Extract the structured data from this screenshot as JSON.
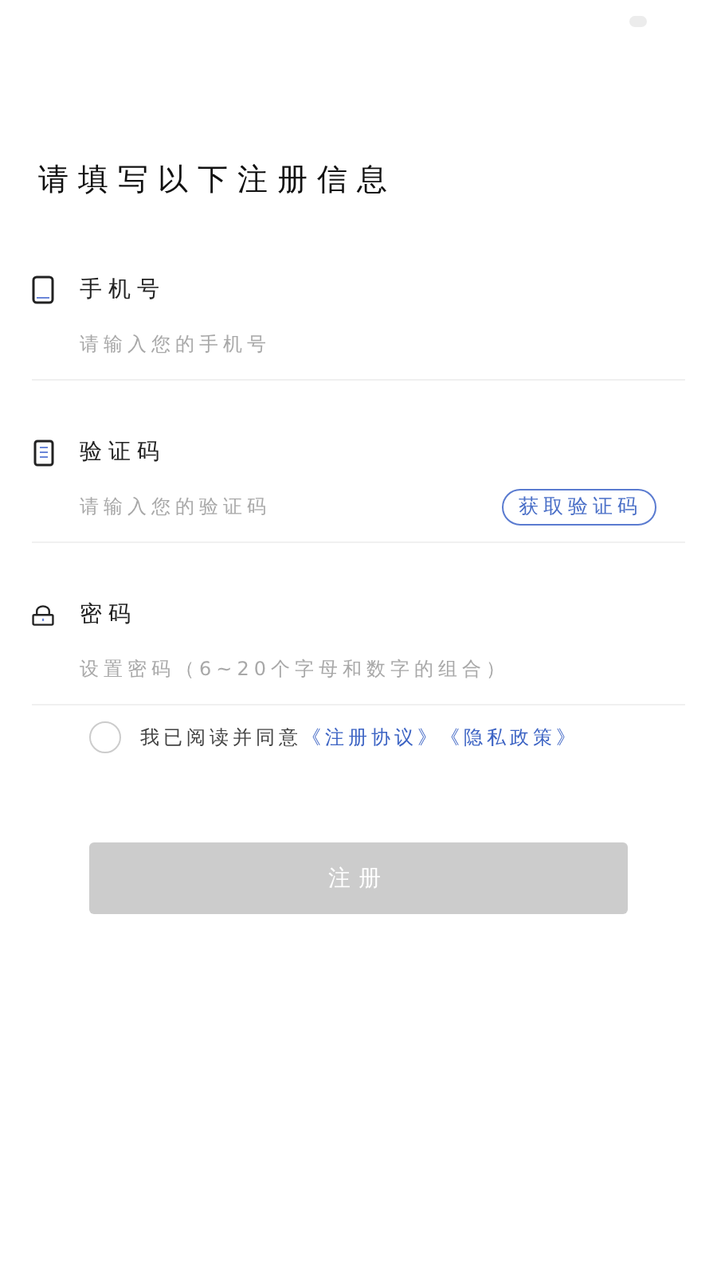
{
  "title": "请填写以下注册信息",
  "fields": [
    {
      "kind": "phone",
      "label": "手机号",
      "placeholder": "请输入您的手机号"
    },
    {
      "kind": "code",
      "label": "验证码",
      "placeholder": "请输入您的验证码",
      "action": "获取验证码"
    },
    {
      "kind": "password",
      "label": "密码",
      "placeholder": "设置密码（6~20个字母和数字的组合）"
    }
  ],
  "agreement": {
    "checked": false,
    "text": "我已阅读并同意",
    "links": [
      "《注册协议》",
      "《隐私政策》"
    ]
  },
  "submit": {
    "label": "注册",
    "disabled": true
  }
}
